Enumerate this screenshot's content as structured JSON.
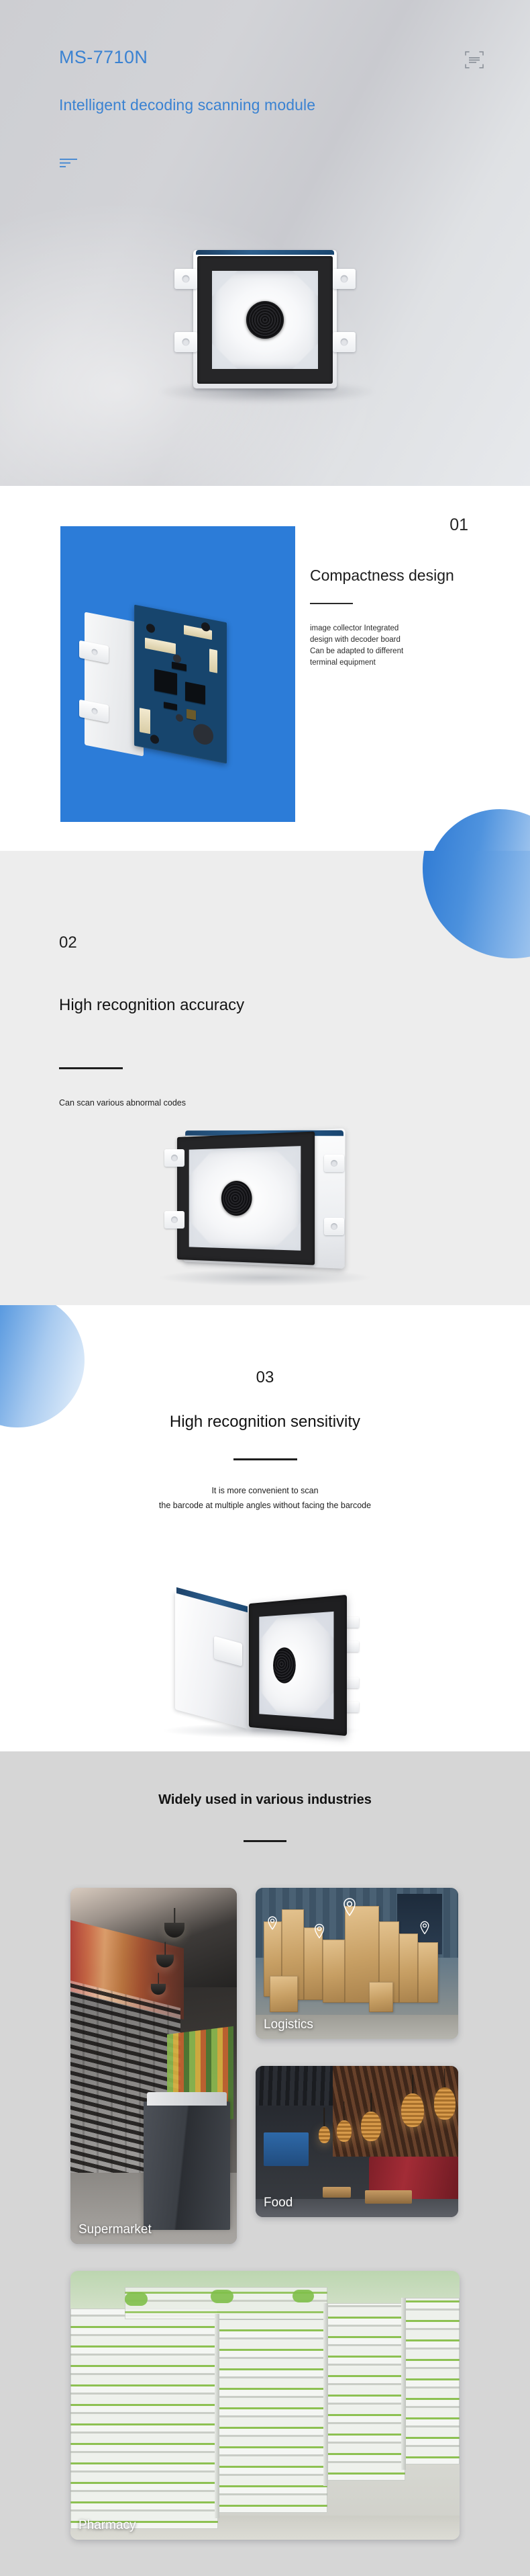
{
  "hero": {
    "title": "MS-7710N",
    "subtitle": "Intelligent decoding scanning module",
    "scan_icon": "scan-frame-icon",
    "lines_icon": "text-lines-icon",
    "accent_color": "#3a82d2",
    "background_color": "#d0d1d5"
  },
  "features": [
    {
      "number": "01",
      "title": "Compactness design",
      "description": "image collector Integrated design with decoder board Can be adapted to different terminal equipment",
      "panel_color": "#2c7cd8",
      "image_alt": "pcb-decoder-board-module"
    },
    {
      "number": "02",
      "title": "High recognition accuracy",
      "description": "Can scan various abnormal codes",
      "background_color": "#ededed",
      "image_alt": "scanning-module-angled-view"
    },
    {
      "number": "03",
      "title": "High recognition sensitivity",
      "description_line1": "It is more convenient to scan",
      "description_line2": "the barcode at multiple angles without facing the barcode",
      "background_color": "#ffffff",
      "image_alt": "scanning-module-perspective-view"
    }
  ],
  "industries": {
    "heading": "Widely used in various industries",
    "background_color": "#d6d6d6",
    "cards": [
      {
        "label": "Supermarket",
        "image_alt": "supermarket-aisle-photo"
      },
      {
        "label": "Logistics",
        "image_alt": "warehouse-boxes-photo"
      },
      {
        "label": "Food",
        "image_alt": "restaurant-interior-photo"
      },
      {
        "label": "Pharmacy",
        "image_alt": "pharmacy-shelves-photo"
      }
    ]
  }
}
